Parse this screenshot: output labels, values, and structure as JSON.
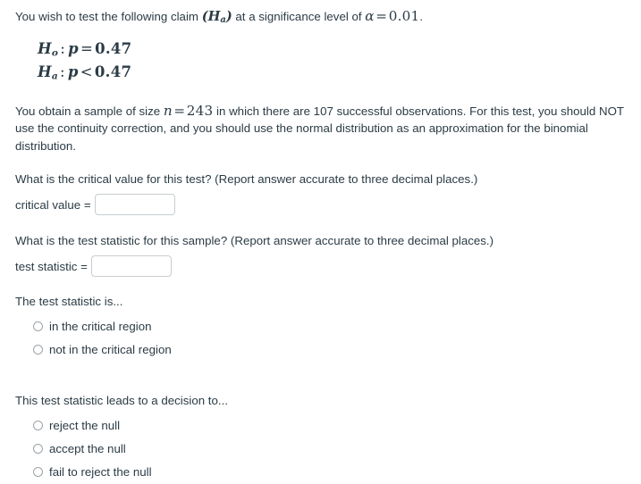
{
  "problem": {
    "intro": {
      "prefix": "You wish to test the following claim ",
      "claim_symbol_open": "(",
      "claim_symbol": "H",
      "claim_symbol_sub": "a",
      "claim_symbol_close": ")",
      "middle": " at a significance level of ",
      "alpha_symbol": "α",
      "alpha_op": "=",
      "alpha_value": "0.01",
      "suffix": "."
    },
    "hypotheses": [
      {
        "symbol": "H",
        "subscript": "o",
        "colon": ":",
        "parameter": "p",
        "relation": "=",
        "value": "0.47"
      },
      {
        "symbol": "H",
        "subscript": "a",
        "colon": ":",
        "parameter": "p",
        "relation": "<",
        "value": "0.47"
      }
    ],
    "sample": {
      "part1": "You obtain a sample of size ",
      "n_symbol": "n",
      "n_op": "=",
      "n_value": "243",
      "part2": " in which there are 107 successful observations. For this test, you should NOT use the continuity correction, and you should use the normal distribution as an approximation for the binomial distribution."
    }
  },
  "questions": {
    "critical_value": {
      "prompt": "What is the critical value for this test? (Report answer accurate to three decimal places.)",
      "label": "critical value =",
      "input_value": "",
      "input_placeholder": ""
    },
    "test_statistic": {
      "prompt": "What is the test statistic for this sample? (Report answer accurate to three decimal places.)",
      "label": "test statistic =",
      "input_value": "",
      "input_placeholder": ""
    },
    "region": {
      "prompt": "The test statistic is...",
      "options": [
        {
          "label": "in the critical region",
          "selected": false
        },
        {
          "label": "not in the critical region",
          "selected": false
        }
      ]
    },
    "decision": {
      "prompt": "This test statistic leads to a decision to...",
      "options": [
        {
          "label": "reject the null",
          "selected": false
        },
        {
          "label": "accept the null",
          "selected": false
        },
        {
          "label": "fail to reject the null",
          "selected": false
        }
      ]
    }
  },
  "theme": {
    "text_color": "#2b3b45",
    "background": "#ffffff",
    "input_border": "#c7cdd1",
    "radio_border": "#9ba3a8"
  }
}
